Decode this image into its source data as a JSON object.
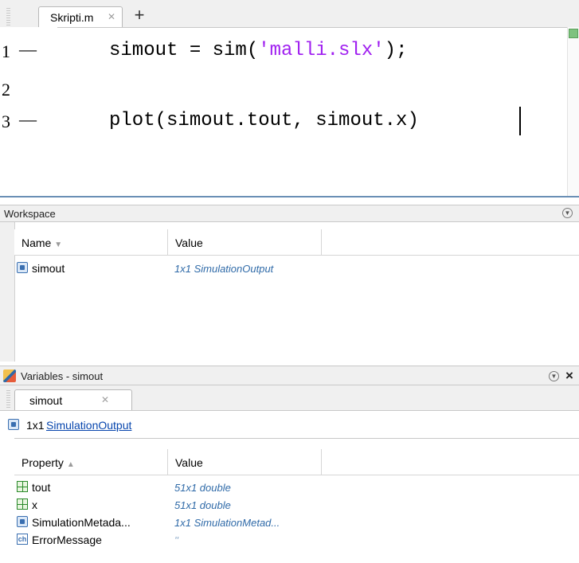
{
  "editor": {
    "tab_label": "Skripti.m",
    "tab_close": "✕",
    "add_tab": "+",
    "lines": [
      {
        "num": "1",
        "marker": "—",
        "code_before": "simout = sim(",
        "code_string": "'malli.slx'",
        "code_after": ");"
      },
      {
        "num": "2",
        "marker": "",
        "code_before": "",
        "code_string": "",
        "code_after": ""
      },
      {
        "num": "3",
        "marker": "—",
        "code_before": "plot(simout.tout, simout.x)",
        "code_string": "",
        "code_after": ""
      }
    ]
  },
  "workspace": {
    "title": "Workspace",
    "columns": {
      "name": "Name",
      "value": "Value"
    },
    "rows": [
      {
        "icon": "struct-icon",
        "name": "simout",
        "value": "1x1 SimulationOutput"
      }
    ]
  },
  "variables": {
    "title": "Variables - simout",
    "tab_label": "simout",
    "tab_close": "✕",
    "summary_size": "1x1",
    "summary_class": "SimulationOutput",
    "columns": {
      "property": "Property",
      "value": "Value"
    },
    "rows": [
      {
        "icon": "numeric-grid-icon",
        "name": "tout",
        "value": "51x1 double"
      },
      {
        "icon": "numeric-grid-icon",
        "name": "x",
        "value": "51x1 double"
      },
      {
        "icon": "struct-icon",
        "name": "SimulationMetada...",
        "value": "1x1 SimulationMetad..."
      },
      {
        "icon": "char-icon",
        "name": "ErrorMessage",
        "value": "''"
      }
    ]
  },
  "colors": {
    "string": "#a020f0",
    "value_text": "#2f6aa8",
    "editor_border": "#6a8fb5"
  }
}
